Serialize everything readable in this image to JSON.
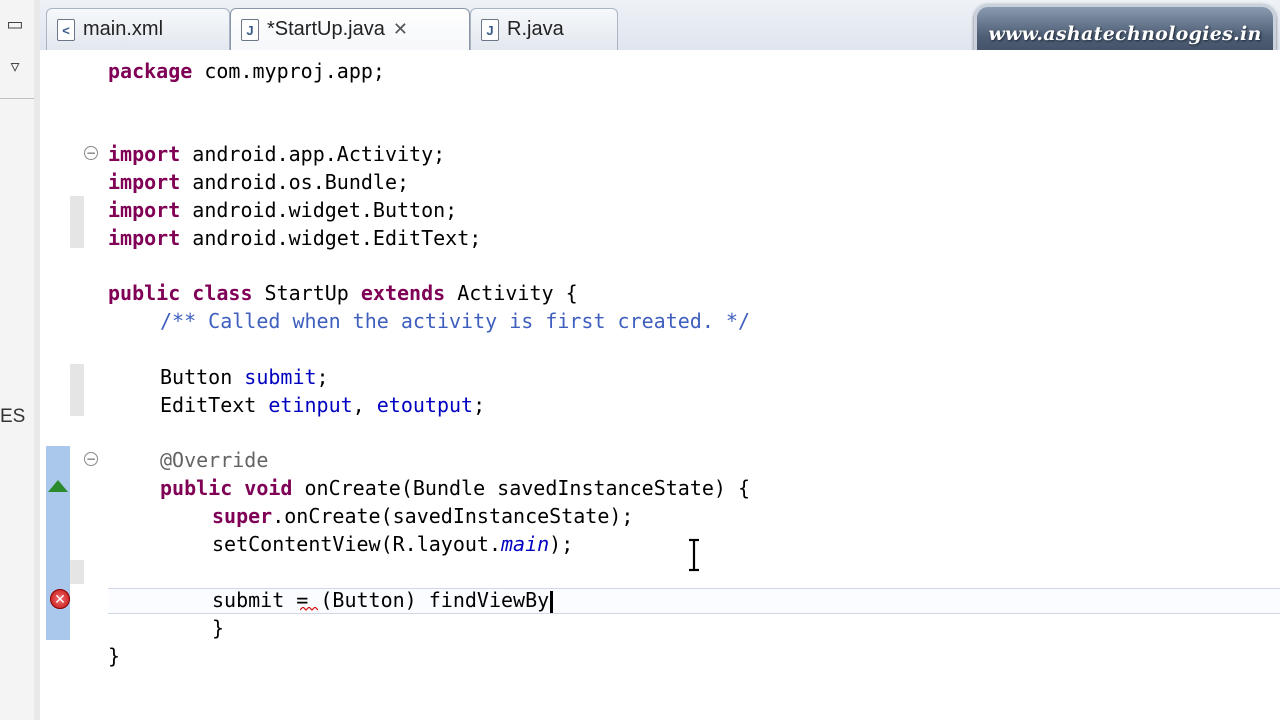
{
  "tabs": [
    {
      "label": "main.xml",
      "icon": "xml-file-icon",
      "active": false
    },
    {
      "label": "*StartUp.java",
      "icon": "java-file-icon",
      "active": true,
      "close": "✕"
    },
    {
      "label": "R.java",
      "icon": "java-file-icon",
      "active": false
    }
  ],
  "watermark": "www.ashatechnologies.in",
  "left_rail_cut_text": "ES",
  "code": {
    "l1": {
      "kw": "package",
      "rest": " com.myproj.app;"
    },
    "l2": {
      "kw": "import",
      "rest": " android.app.Activity;"
    },
    "l3": {
      "kw": "import",
      "rest": " android.os.Bundle;"
    },
    "l4": {
      "kw": "import",
      "rest": " android.widget.Button;"
    },
    "l5": {
      "kw": "import",
      "rest": " android.widget.EditText;"
    },
    "l6": {
      "kw1": "public",
      "kw2": "class",
      "name": " StartUp ",
      "kw3": "extends",
      "rest": " Activity {"
    },
    "l7": {
      "comment": "/** Called when the activity is first created. */"
    },
    "l8": {
      "type": "Button ",
      "field": "submit",
      "rest": ";"
    },
    "l9": {
      "type": "EditText ",
      "f1": "etinput",
      "sep": ", ",
      "f2": "etoutput",
      "rest": ";"
    },
    "l10": {
      "ann": "@Override"
    },
    "l11": {
      "kw1": "public",
      "kw2": "void",
      "rest": " onCreate(Bundle savedInstanceState) {"
    },
    "l12": {
      "kw": "super",
      "rest": ".onCreate(savedInstanceState);"
    },
    "l13": {
      "pre": "setContentView(R.layout.",
      "ital": "main",
      "post": ");"
    },
    "l14": {
      "field": "submit",
      "eq": " = ",
      "rest": "(Button) findViewBy"
    },
    "l15": {
      "text": "}"
    },
    "l16": {
      "text": "}"
    }
  },
  "colors": {
    "keyword": "#7f0055",
    "comment": "#3f5fbf",
    "field": "#0000c0",
    "annotation": "#646464",
    "error": "#c41010"
  }
}
